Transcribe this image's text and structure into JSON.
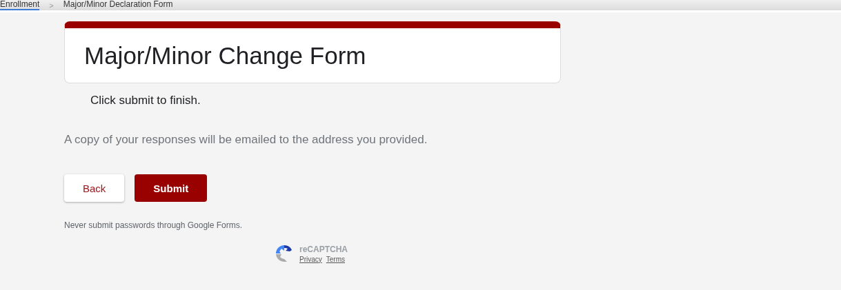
{
  "breadcrumb": {
    "items": [
      {
        "label": "Enrollment",
        "selected": true
      },
      {
        "label": "Major/Minor Declaration Form",
        "selected": false
      }
    ],
    "separator": ">"
  },
  "form": {
    "title": "Major/Minor Change Form",
    "message": "Click submit to finish.",
    "copy_notice": "A copy of your responses will be emailed to the address you provided.",
    "buttons": [
      {
        "label": "Back",
        "kind": "secondary"
      },
      {
        "label": "Submit",
        "kind": "primary"
      }
    ],
    "warning": "Never submit passwords through Google Forms."
  },
  "recaptcha": {
    "name": "reCAPTCHA",
    "links": [
      "Privacy",
      "Terms"
    ]
  }
}
